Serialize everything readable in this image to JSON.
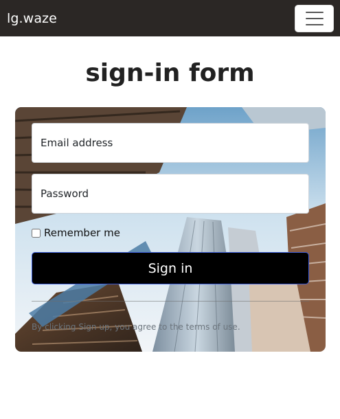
{
  "navbar": {
    "brand": "lg.waze",
    "menu_icon": "hamburger-menu-icon"
  },
  "form": {
    "title": "sign-in form",
    "email_placeholder": "Email address",
    "password_placeholder": "Password",
    "remember_label": "Remember me",
    "remember_checked": false,
    "submit_label": "Sign in",
    "terms_text": "By clicking Sign up, you agree to the terms of use."
  },
  "colors": {
    "navbar_bg": "#2b2725",
    "button_bg": "#000000",
    "button_border": "#3a5bd9"
  }
}
